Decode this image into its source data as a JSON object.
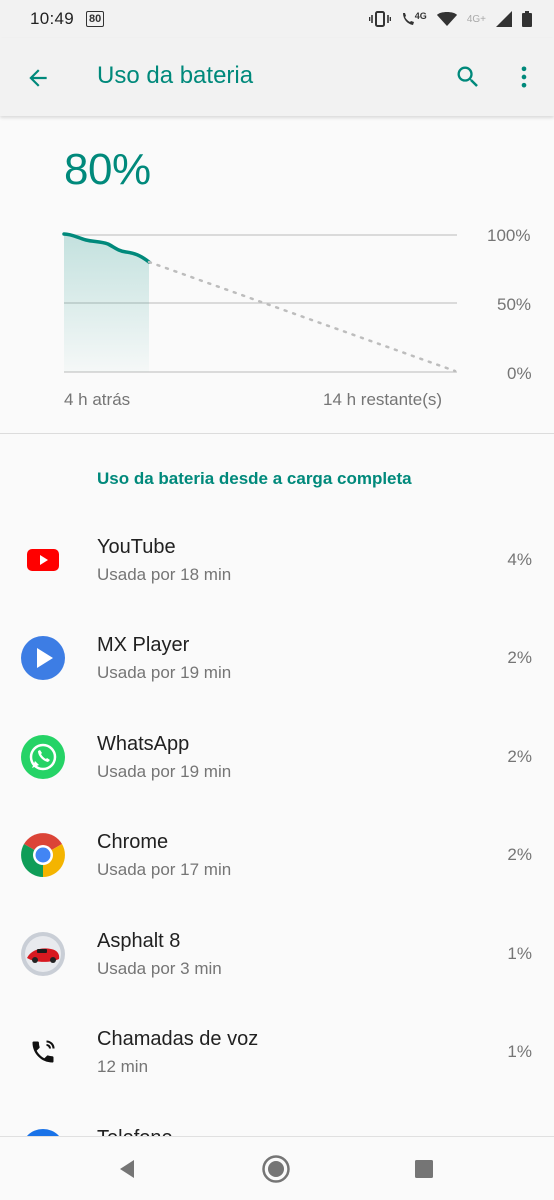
{
  "status_bar": {
    "time": "10:49",
    "badge": "80",
    "network_label": "4G+",
    "lte_label": "4G",
    "icons": [
      "vibrate-icon",
      "call-lte-icon",
      "wifi-icon",
      "signal-icon",
      "battery-icon"
    ]
  },
  "app_bar": {
    "title": "Uso da bateria",
    "icons": [
      "back-arrow-icon",
      "search-icon",
      "more-vert-icon"
    ]
  },
  "battery": {
    "level": "80%",
    "level_fraction": 0.8,
    "accent_color": "#00897b"
  },
  "graph": {
    "y_labels": [
      "100%",
      "50%",
      "0%"
    ],
    "x_label_left": "4 h atrás",
    "x_label_right": "14 h restante(s)"
  },
  "section": {
    "title": "Uso da bateria desde a carga completa"
  },
  "apps": [
    {
      "name": "YouTube",
      "usage": "Usada por 18 min",
      "percent": "4%",
      "icon": "youtube-icon"
    },
    {
      "name": "MX Player",
      "usage": "Usada por 19 min",
      "percent": "2%",
      "icon": "mx-player-icon"
    },
    {
      "name": "WhatsApp",
      "usage": "Usada por 19 min",
      "percent": "2%",
      "icon": "whatsapp-icon"
    },
    {
      "name": "Chrome",
      "usage": "Usada por 17 min",
      "percent": "2%",
      "icon": "chrome-icon"
    },
    {
      "name": "Asphalt 8",
      "usage": "Usada por 3 min",
      "percent": "1%",
      "icon": "asphalt-icon"
    },
    {
      "name": "Chamadas de voz",
      "usage": "12 min",
      "percent": "1%",
      "icon": "voice-call-icon"
    },
    {
      "name": "Telefone",
      "usage": "",
      "percent": "",
      "icon": "phone-icon"
    }
  ],
  "nav_bar": {
    "icons": [
      "nav-back-icon",
      "nav-home-icon",
      "nav-recents-icon"
    ]
  }
}
